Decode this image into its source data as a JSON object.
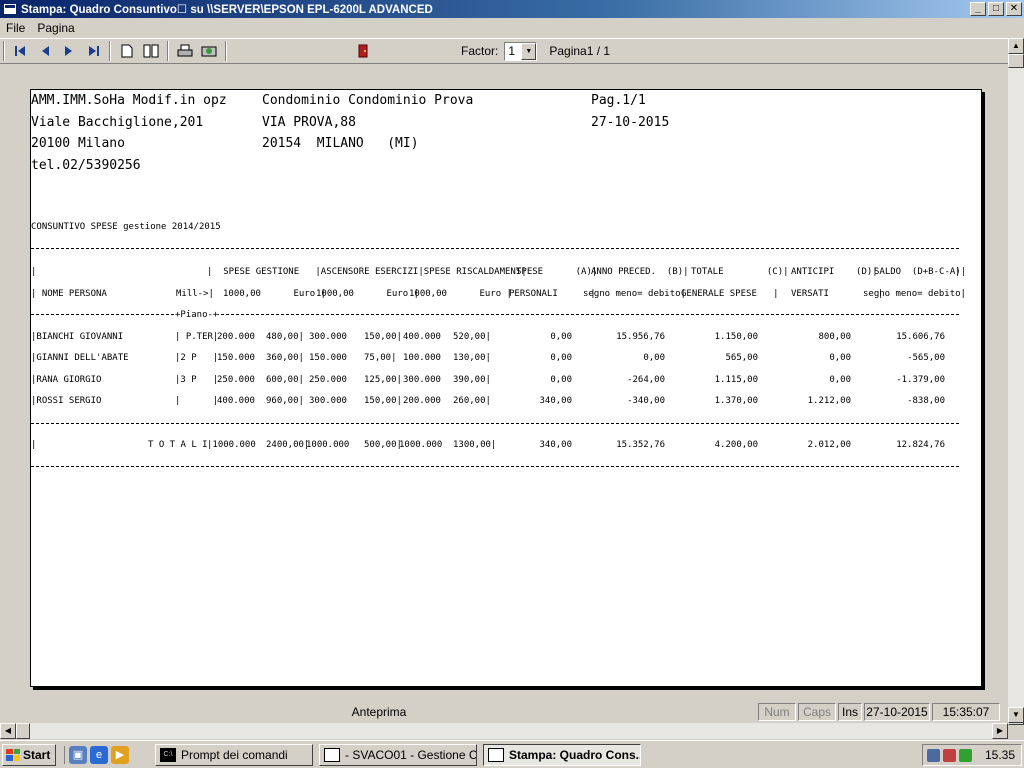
{
  "window": {
    "title": "Stampa: Quadro Consuntivo☐ su \\\\SERVER\\EPSON EPL-6200L ADVANCED",
    "min": "_",
    "max": "□",
    "close": "✕"
  },
  "menu": [
    "File",
    "Pagina"
  ],
  "toolbar": {
    "factor_label": "Factor:",
    "factor_value": "1",
    "page_label": "Pagina1 / 1",
    "icons": [
      "first-page-icon",
      "prev-page-icon",
      "next-page-icon",
      "last-page-icon",
      "single-page-icon",
      "two-pages-icon",
      "print-icon",
      "page-setup-icon",
      "exit-door-icon"
    ]
  },
  "report": {
    "header_left": [
      "AMM.IMM.SoHa Modif.in opz",
      "Viale Bacchiglione,201",
      "20100 Milano",
      "tel.02/5390256"
    ],
    "header_mid": [
      "Condominio Condominio Prova",
      "VIA PROVA,88",
      "20154  MILANO   (MI)"
    ],
    "header_right": [
      "Pag.1/1",
      "27-10-2015"
    ],
    "section_title": "CONSUNTIVO SPESE gestione 2014/2015",
    "col_head1": [
      "|",
      "|  SPESE GESTIONE   |ASCENSORE ESERCIZI|SPESE RISCALDAMENT|",
      "SPESE      (A)|",
      "ANNO PRECED.  (B)|",
      "TOTALE        (C)|",
      "ANTICIPI    (D)|",
      "SALDO  (D+B-C-A)|"
    ],
    "col_head2": [
      "| NOME PERSONA",
      "Mill->|",
      "1000,00      Euro |",
      "1000,00      Euro |",
      "1000,00      Euro |",
      "PERSONALI      |",
      "segno meno= debito|",
      "GENERALE SPESE   |",
      "VERSATI         |",
      "segno meno= debito|"
    ],
    "piano": "+Piano-+",
    "rows": [
      {
        "name": "|BIANCHI GIOVANNI",
        "piano": "| P.TER|",
        "g": "200.000",
        "ge": "480,00|",
        "a": "300.000",
        "ae": "150,00|",
        "r": "400.000",
        "re": "520,00|",
        "sp": "0,00",
        "ap": "15.956,76",
        "tot": "1.150,00",
        "ant": "800,00",
        "saldo": "15.606,76"
      },
      {
        "name": "|GIANNI DELL'ABATE",
        "piano": "|2 P   |",
        "g": "150.000",
        "ge": "360,00|",
        "a": "150.000",
        "ae": "75,00|",
        "r": "100.000",
        "re": "130,00|",
        "sp": "0,00",
        "ap": "0,00",
        "tot": "565,00",
        "ant": "0,00",
        "saldo": "-565,00"
      },
      {
        "name": "|RANA GIORGIO",
        "piano": "|3 P   |",
        "g": "250.000",
        "ge": "600,00|",
        "a": "250.000",
        "ae": "125,00|",
        "r": "300.000",
        "re": "390,00|",
        "sp": "0,00",
        "ap": "-264,00",
        "tot": "1.115,00",
        "ant": "0,00",
        "saldo": "-1.379,00"
      },
      {
        "name": "|ROSSI SERGIO",
        "piano": "|      |",
        "g": "400.000",
        "ge": "960,00|",
        "a": "300.000",
        "ae": "150,00|",
        "r": "200.000",
        "re": "260,00|",
        "sp": "340,00",
        "ap": "-340,00",
        "tot": "1.370,00",
        "ant": "1.212,00",
        "saldo": "-838,00"
      }
    ],
    "totals": {
      "label": "T O T A L I",
      "g": "|1000.000",
      "ge": "2400,00|",
      "a": "1000.000",
      "ae": "500,00|",
      "r": "1000.000",
      "re": "1300,00|",
      "sp": "340,00",
      "ap": "15.352,76",
      "tot": "4.200,00",
      "ant": "2.012,00",
      "saldo": "12.824,76"
    }
  },
  "status": {
    "main": "Anteprima",
    "num": "Num",
    "caps": "Caps",
    "ins": "Ins",
    "date": "27-10-2015",
    "time": "15:35:07"
  },
  "taskbar": {
    "start": "Start",
    "tasks": [
      "Prompt dei comandi",
      "- SVACO01 - Gestione C...",
      "Stampa: Quadro Cons..."
    ],
    "clock": "15.35"
  }
}
